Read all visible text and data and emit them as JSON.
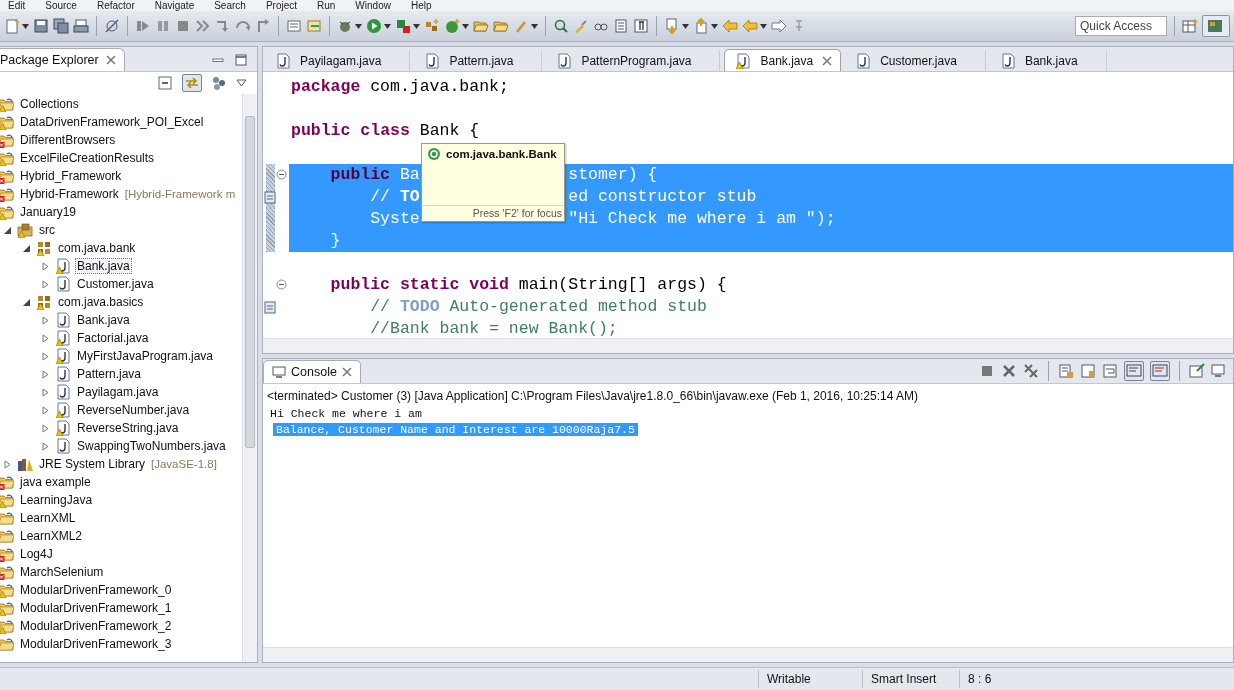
{
  "menu": [
    "Edit",
    "Source",
    "Refactor",
    "Navigate",
    "Search",
    "Project",
    "Run",
    "Window",
    "Help"
  ],
  "quick_access": {
    "placeholder": "Quick Access"
  },
  "package_explorer": {
    "title": "Package Explorer",
    "tree": [
      {
        "label": "Collections",
        "kind": "project",
        "warning": true,
        "error": false,
        "selected": false
      },
      {
        "label": "DataDrivenFramework_POI_Excel",
        "kind": "project",
        "warning": true,
        "error": false,
        "selected": false
      },
      {
        "label": "DifferentBrowsers",
        "kind": "project",
        "warning": false,
        "error": true,
        "selected": false
      },
      {
        "label": "ExcelFileCreationResults",
        "kind": "project",
        "warning": true,
        "error": false,
        "selected": false
      },
      {
        "label": "Hybrid_Framework",
        "kind": "project",
        "warning": false,
        "error": true,
        "selected": false
      },
      {
        "label": "Hybrid-Framework",
        "kind": "project",
        "warning": false,
        "error": true,
        "decoration": "[Hybrid-Framework m",
        "selected": false
      },
      {
        "label": "January19",
        "kind": "project",
        "warning": true,
        "error": false,
        "selected": false,
        "children": [
          {
            "label": "src",
            "kind": "source-folder",
            "warning": true,
            "error": false,
            "expanded": true,
            "selected": false,
            "children": [
              {
                "label": "com.java.bank",
                "kind": "package",
                "warning": true,
                "error": false,
                "expanded": true,
                "selected": false,
                "children": [
                  {
                    "label": "Bank.java",
                    "kind": "java-file",
                    "warning": true,
                    "error": false,
                    "expanded": false,
                    "selected": true
                  },
                  {
                    "label": "Customer.java",
                    "kind": "java-file",
                    "warning": false,
                    "error": false,
                    "expanded": false,
                    "selected": false
                  }
                ]
              },
              {
                "label": "com.java.basics",
                "kind": "package",
                "warning": true,
                "error": false,
                "expanded": true,
                "selected": false,
                "children": [
                  {
                    "label": "Bank.java",
                    "kind": "java-file",
                    "warning": false,
                    "error": false,
                    "expanded": false,
                    "selected": false
                  },
                  {
                    "label": "Factorial.java",
                    "kind": "java-file",
                    "warning": true,
                    "error": false,
                    "expanded": false,
                    "selected": false
                  },
                  {
                    "label": "MyFirstJavaProgram.java",
                    "kind": "java-file",
                    "warning": true,
                    "error": false,
                    "expanded": false,
                    "selected": false
                  },
                  {
                    "label": "Pattern.java",
                    "kind": "java-file",
                    "warning": false,
                    "error": false,
                    "expanded": false,
                    "selected": false
                  },
                  {
                    "label": "Payilagam.java",
                    "kind": "java-file",
                    "warning": false,
                    "error": false,
                    "expanded": false,
                    "selected": false
                  },
                  {
                    "label": "ReverseNumber.java",
                    "kind": "java-file",
                    "warning": true,
                    "error": false,
                    "expanded": false,
                    "selected": false
                  },
                  {
                    "label": "ReverseString.java",
                    "kind": "java-file",
                    "warning": true,
                    "error": false,
                    "expanded": false,
                    "selected": false
                  },
                  {
                    "label": "SwappingTwoNumbers.java",
                    "kind": "java-file",
                    "warning": false,
                    "error": false,
                    "expanded": false,
                    "selected": false
                  }
                ]
              }
            ]
          },
          {
            "label": "JRE System Library",
            "kind": "library",
            "warning": false,
            "error": false,
            "decoration": "[JavaSE-1.8]",
            "expanded": false,
            "selected": false
          }
        ]
      },
      {
        "label": "java example",
        "kind": "project",
        "warning": false,
        "error": true,
        "selected": false
      },
      {
        "label": "LearningJava",
        "kind": "project",
        "warning": true,
        "error": false,
        "selected": false
      },
      {
        "label": "LearnXML",
        "kind": "project",
        "warning": false,
        "error": false,
        "selected": false
      },
      {
        "label": "LearnXML2",
        "kind": "project",
        "warning": false,
        "error": false,
        "selected": false
      },
      {
        "label": "Log4J",
        "kind": "project",
        "warning": false,
        "error": true,
        "selected": false
      },
      {
        "label": "MarchSelenium",
        "kind": "project",
        "warning": false,
        "error": true,
        "selected": false
      },
      {
        "label": "ModularDrivenFramework_0",
        "kind": "project",
        "warning": true,
        "error": false,
        "selected": false
      },
      {
        "label": "ModularDrivenFramework_1",
        "kind": "project",
        "warning": true,
        "error": false,
        "selected": false
      },
      {
        "label": "ModularDrivenFramework_2",
        "kind": "project",
        "warning": true,
        "error": false,
        "selected": false
      },
      {
        "label": "ModularDrivenFramework_3",
        "kind": "project",
        "warning": false,
        "error": false,
        "selected": false
      }
    ]
  },
  "editor": {
    "tabs": [
      {
        "label": "Payilagam.java",
        "selected": false,
        "warning": false
      },
      {
        "label": "Pattern.java",
        "selected": false,
        "warning": false
      },
      {
        "label": "PatternProgram.java",
        "selected": false,
        "warning": false
      },
      {
        "label": "Bank.java",
        "selected": true,
        "warning": true
      },
      {
        "label": "Customer.java",
        "selected": false,
        "warning": false
      },
      {
        "label": "Bank.java",
        "selected": false,
        "warning": false
      }
    ],
    "lines": [
      {
        "selected": false,
        "kind": "plain",
        "parts": [
          [
            {
              "kind": "keyword",
              "text": "package"
            },
            {
              "kind": "plain",
              "text": " com.java.bank;"
            }
          ]
        ]
      },
      {
        "selected": false,
        "kind": "plain"
      },
      {
        "selected": false,
        "kind": "plain",
        "parts": [
          [
            {
              "kind": "keyword",
              "text": "public"
            },
            {
              "kind": "keyword",
              "text": " class"
            },
            {
              "kind": "plain",
              "text": " Bank {"
            }
          ]
        ],
        "children": [
          {
            "selected": false,
            "kind": "plain"
          },
          {
            "selected": true,
            "kind": "fold",
            "parts": [
              [
                {
                  "kind": "keyword",
                  "text": "public"
                },
                {
                  "kind": "plain",
                  "text": " Ba"
                }
              ],
              [
                {
                  "kind": "plain",
                  "text": "stomer) {"
                }
              ]
            ],
            "children": [
              {
                "selected": true,
                "kind": "task",
                "parts": [
                  [
                    {
                      "kind": "comment",
                      "text": "// "
                    },
                    {
                      "kind": "task",
                      "text": "TO"
                    }
                  ],
                  [
                    {
                      "kind": "comment",
                      "text": "ed constructor stub"
                    }
                  ]
                ]
              },
              {
                "selected": true,
                "kind": "plain",
                "parts": [
                  [
                    {
                      "kind": "plain",
                      "text": "Syste"
                    }
                  ],
                  [
                    {
                      "kind": "string",
                      "text": "\"Hi Check me where i am \""
                    },
                    {
                      "kind": "plain",
                      "text": ");"
                    }
                  ]
                ]
              }
            ]
          },
          {
            "selected": true,
            "kind": "plain",
            "parts": [
              [
                {
                  "kind": "plain",
                  "text": "}"
                }
              ]
            ]
          },
          {
            "selected": false,
            "kind": "plain"
          },
          {
            "selected": false,
            "kind": "fold",
            "parts": [
              [
                {
                  "kind": "keyword",
                  "text": "public"
                },
                {
                  "kind": "keyword",
                  "text": " static"
                },
                {
                  "kind": "keyword",
                  "text": " void"
                },
                {
                  "kind": "plain",
                  "text": " main(String[] args) {"
                }
              ]
            ],
            "children": [
              {
                "selected": false,
                "kind": "task",
                "parts": [
                  [
                    {
                      "kind": "comment",
                      "text": "// "
                    },
                    {
                      "kind": "task",
                      "text": "TODO"
                    },
                    {
                      "kind": "comment",
                      "text": " Auto-generated method stub"
                    }
                  ]
                ]
              },
              {
                "selected": false,
                "kind": "plain",
                "parts": [
                  [
                    {
                      "kind": "comment",
                      "text": "//Bank bank = new Bank();"
                    }
                  ]
                ]
              }
            ]
          }
        ]
      }
    ],
    "hover": {
      "title": "com.java.bank.Bank",
      "footer": "Press 'F2' for focus"
    }
  },
  "console": {
    "title": "Console",
    "process": "<terminated> Customer (3) [Java Application] C:\\Program Files\\Java\\jre1.8.0_66\\bin\\javaw.exe (Feb 1, 2016, 10:25:14 AM)",
    "output": [
      {
        "text": "Hi Check me where i am",
        "selected": false
      },
      {
        "text": "Balance, Customer Name and Interest are 10000Raja7.5",
        "selected": true
      }
    ]
  },
  "status_bar": [
    "Writable",
    "Smart Insert",
    "8 : 6"
  ]
}
